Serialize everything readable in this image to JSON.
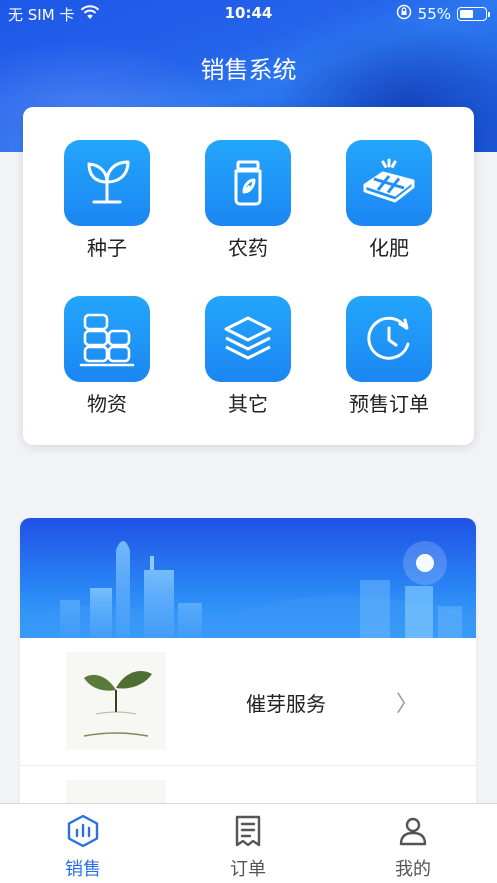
{
  "status_bar": {
    "carrier": "无 SIM 卡",
    "time": "10:44",
    "battery_pct": "55%",
    "battery_level": 0.55
  },
  "header": {
    "title": "销售系统"
  },
  "categories": [
    {
      "label": "种子",
      "icon": "sprout-icon"
    },
    {
      "label": "农药",
      "icon": "pesticide-bottle-icon"
    },
    {
      "label": "化肥",
      "icon": "fertilizer-grid-icon"
    },
    {
      "label": "物资",
      "icon": "storage-barrels-icon"
    },
    {
      "label": "其它",
      "icon": "layers-icon"
    },
    {
      "label": "预售订单",
      "icon": "clock-refresh-icon"
    }
  ],
  "services": [
    {
      "name": "催芽服务",
      "icon": "seedling-image"
    }
  ],
  "tabbar": {
    "items": [
      {
        "label": "销售",
        "icon": "sales-chart-icon",
        "active": true
      },
      {
        "label": "订单",
        "icon": "receipt-icon",
        "active": false
      },
      {
        "label": "我的",
        "icon": "user-icon",
        "active": false
      }
    ],
    "active_color": "#2b6fe6",
    "inactive_color": "#555555"
  },
  "colors": {
    "primary": "#1f5ee8",
    "tile": "#1e8ff6"
  }
}
